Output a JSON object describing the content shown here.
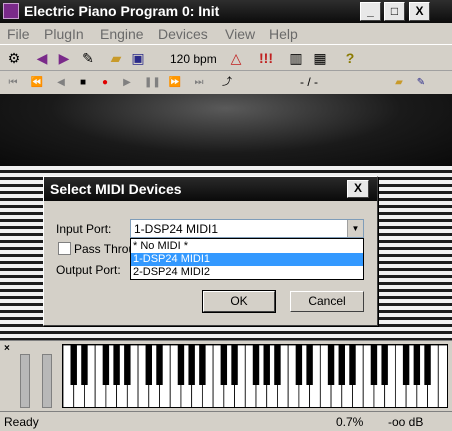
{
  "window": {
    "title": "Electric Piano Program 0: Init",
    "minimize": "_",
    "maximize": "□",
    "close": "X"
  },
  "menu": [
    "File",
    "PlugIn",
    "Engine",
    "Devices",
    "View",
    "Help"
  ],
  "toolbar": {
    "tempo": "120 bpm"
  },
  "transport": {
    "position": "- / -"
  },
  "dialog": {
    "title": "Select MIDI Devices",
    "close": "X",
    "input_port_label": "Input Port:",
    "input_port_value": "1-DSP24 MIDI1",
    "pass_through_label": "Pass Throu",
    "output_port_label": "Output Port:",
    "dropdown_options": [
      "* No MIDI *",
      "1-DSP24 MIDI1",
      "2-DSP24 MIDI2"
    ],
    "selected_option_index": 1,
    "ok": "OK",
    "cancel": "Cancel"
  },
  "status": {
    "text": "Ready",
    "cpu": "0.7%",
    "level": "-oo dB"
  },
  "colors": {
    "selection": "#3399ff",
    "titlebar": "#0c0c0c"
  }
}
